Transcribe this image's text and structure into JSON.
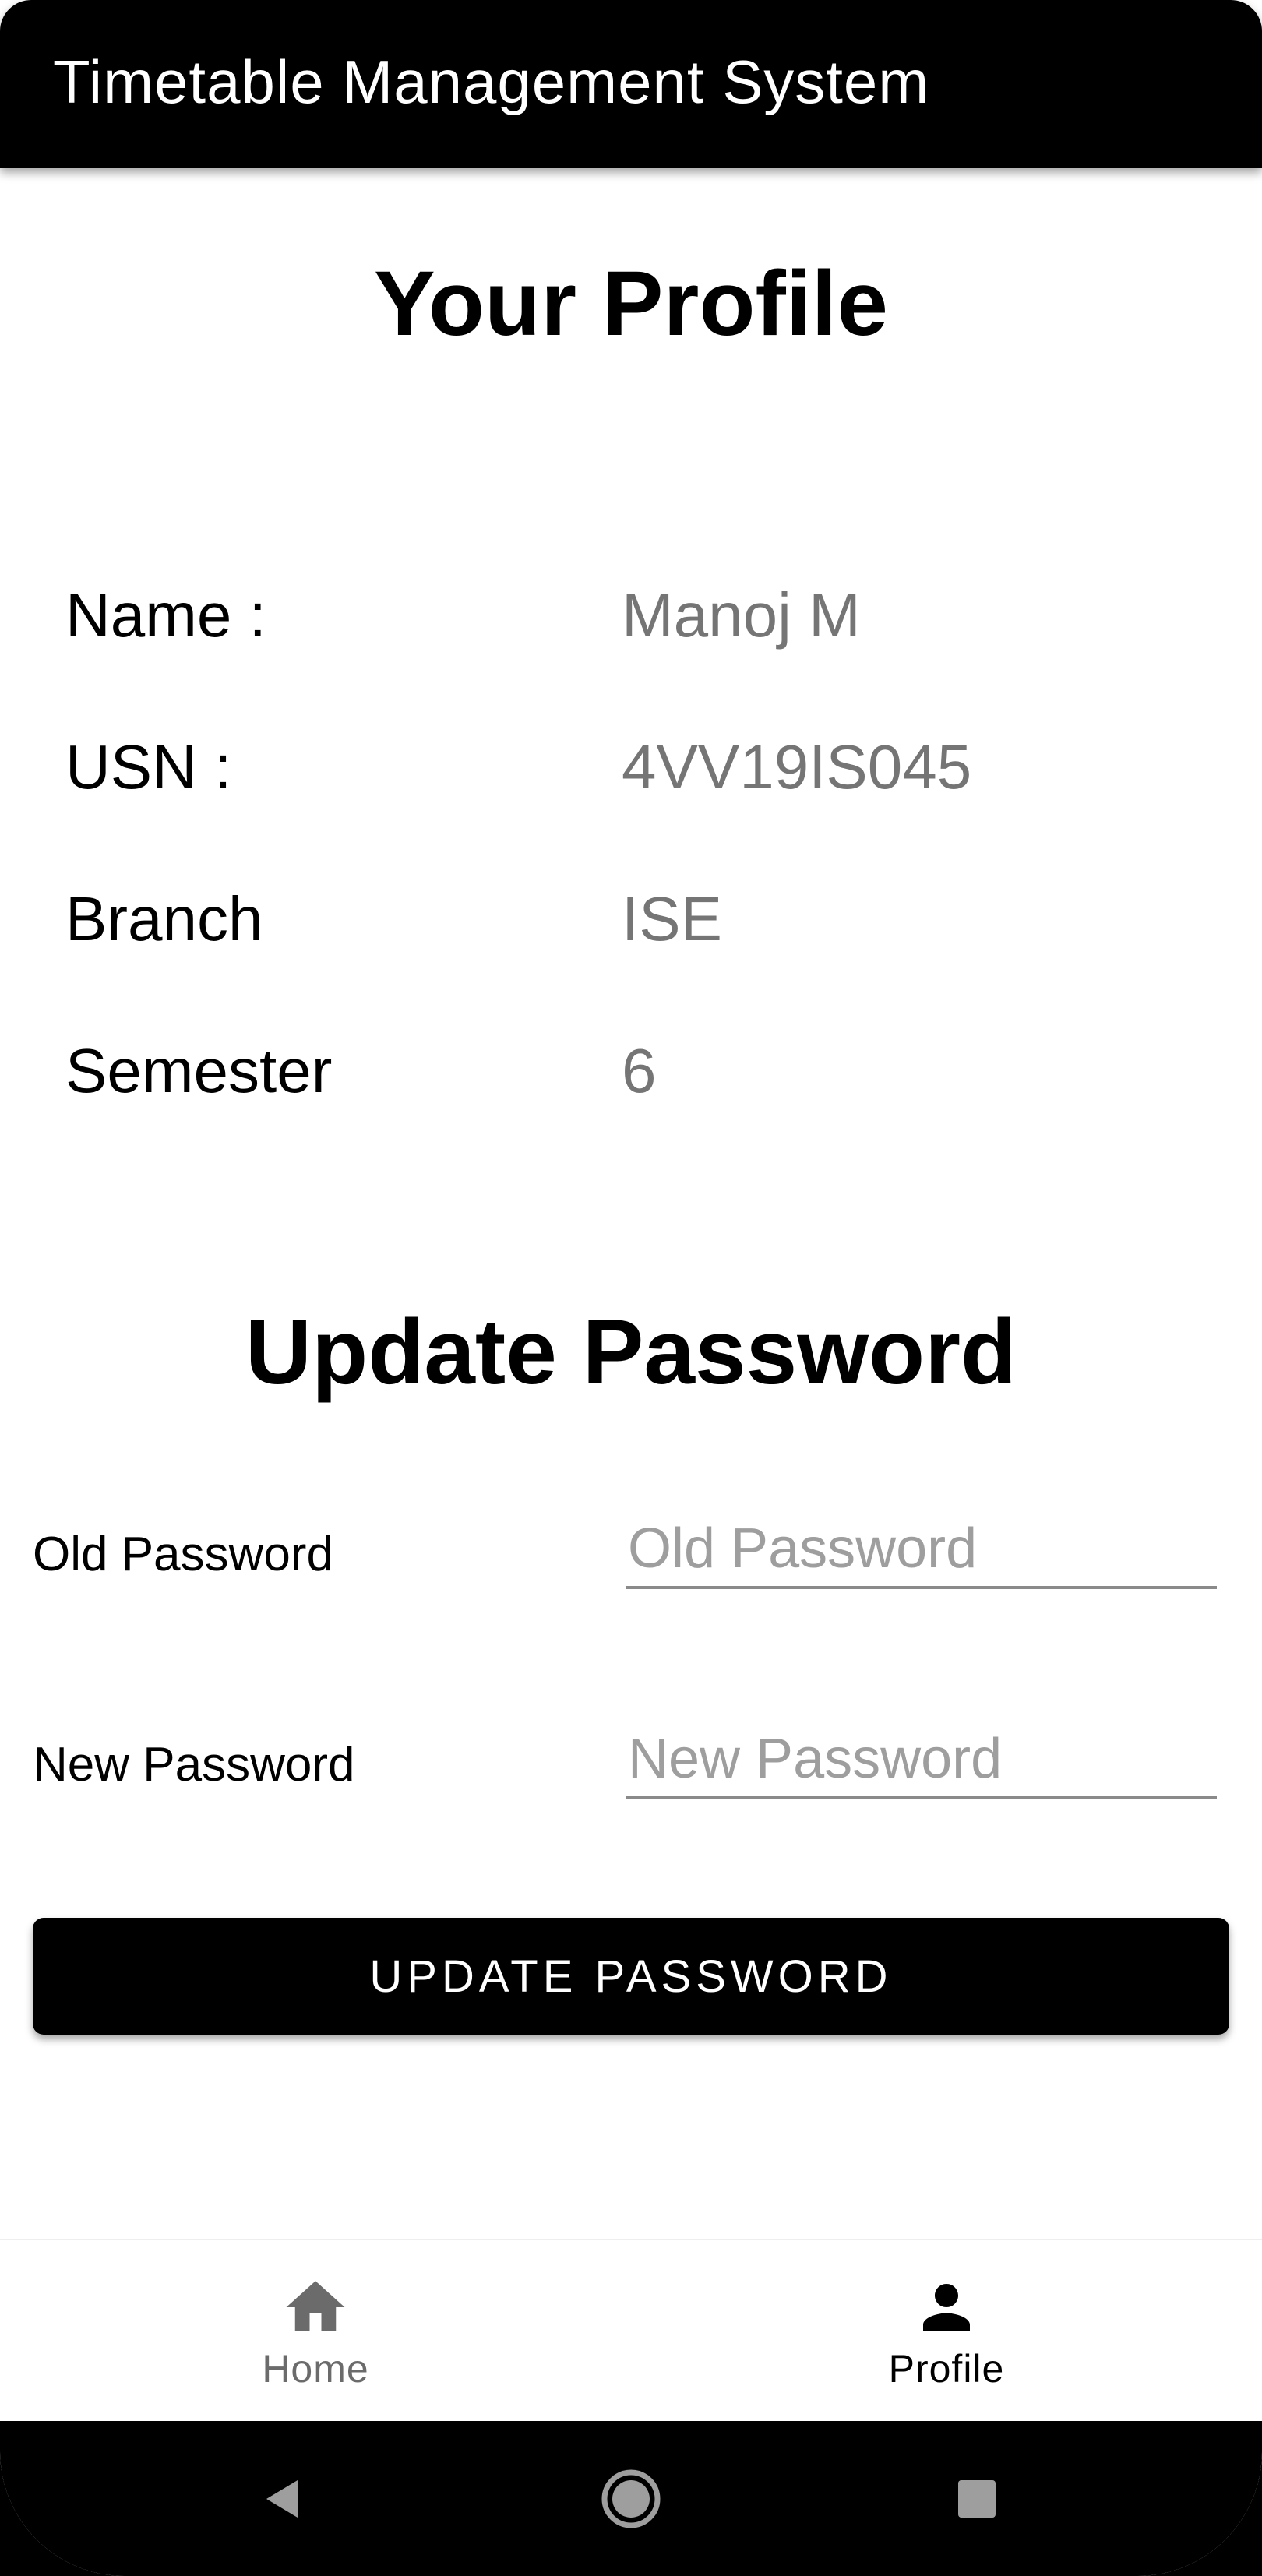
{
  "app_bar": {
    "title": "Timetable Management System"
  },
  "profile": {
    "heading": "Your Profile",
    "rows": [
      {
        "label": "Name :",
        "value": "Manoj M"
      },
      {
        "label": "USN :",
        "value": "4VV19IS045"
      },
      {
        "label": "Branch",
        "value": "ISE"
      },
      {
        "label": "Semester",
        "value": "6"
      }
    ]
  },
  "password_form": {
    "heading": "Update Password",
    "old_label": "Old Password",
    "old_placeholder": "Old Password",
    "old_value": "",
    "new_label": "New Password",
    "new_placeholder": "New Password",
    "new_value": "",
    "submit_label": "UPDATE PASSWORD"
  },
  "bottom_nav": {
    "items": [
      {
        "label": "Home",
        "icon": "home-icon",
        "active": false
      },
      {
        "label": "Profile",
        "icon": "person-icon",
        "active": true
      }
    ]
  },
  "system_nav": {
    "icons": [
      "back-icon",
      "home-circle-icon",
      "recents-icon"
    ]
  },
  "colors": {
    "app_bar_bg": "#000000",
    "button_bg": "#000000",
    "value_text": "#757575",
    "inactive_nav": "#6b6b6b"
  }
}
